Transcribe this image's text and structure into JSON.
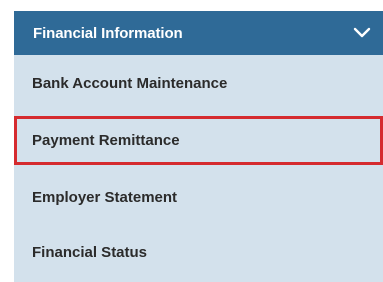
{
  "panel": {
    "header": {
      "title": "Financial Information",
      "icon": "chevron-down-icon",
      "background": "#2f6a97"
    },
    "items": [
      {
        "label": "Bank Account Maintenance"
      },
      {
        "label": "Payment Remittance",
        "highlighted": true
      },
      {
        "label": "Employer Statement"
      },
      {
        "label": "Financial Status"
      }
    ],
    "colors": {
      "panel_background": "#d3e1ec",
      "highlight_border": "#d52b2f",
      "text": "#2b2b2b"
    }
  }
}
